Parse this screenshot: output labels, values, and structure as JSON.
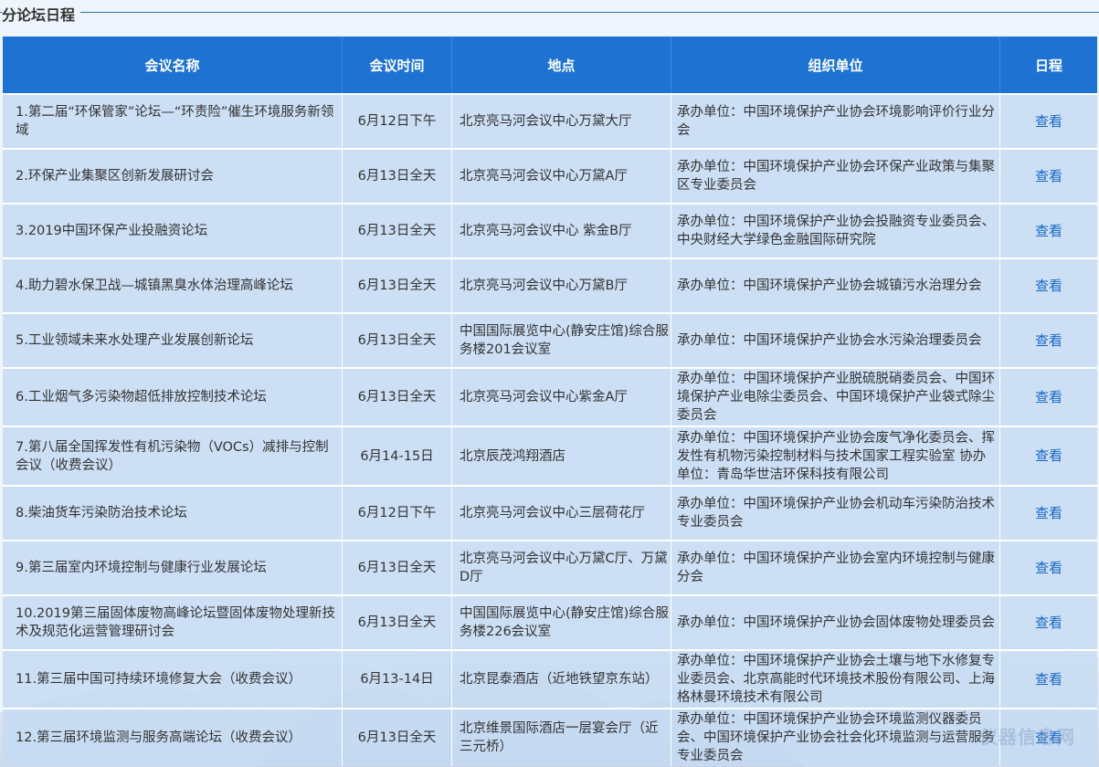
{
  "section": {
    "title": "分论坛日程"
  },
  "table": {
    "headers": [
      "会议名称",
      "会议时间",
      "地点",
      "组织单位",
      "日程"
    ],
    "rows": [
      {
        "name": "1.第二届“环保管家”论坛—“环责险”催生环境服务新领域",
        "time": "6月12日下午",
        "location": "北京亮马河会议中心万黛大厅",
        "organizer": "承办单位：中国环境保护产业协会环境影响评价行业分会",
        "action": "查看"
      },
      {
        "name": "2.环保产业集聚区创新发展研讨会",
        "time": "6月13日全天",
        "location": "北京亮马河会议中心万黛A厅",
        "organizer": "承办单位：中国环境保护产业协会环保产业政策与集聚区专业委员会",
        "action": "查看"
      },
      {
        "name": "3.2019中国环保产业投融资论坛",
        "time": "6月13日全天",
        "location": "北京亮马河会议中心 紫金B厅",
        "organizer": "承办单位：中国环境保护产业协会投融资专业委员会、 中央财经大学绿色金融国际研究院",
        "action": "查看"
      },
      {
        "name": "4.助力碧水保卫战—城镇黑臭水体治理高峰论坛",
        "time": "6月13日全天",
        "location": "北京亮马河会议中心万黛B厅",
        "organizer": "承办单位：中国环境保护产业协会城镇污水治理分会",
        "action": "查看"
      },
      {
        "name": "5.工业领域未来水处理产业发展创新论坛",
        "time": "6月13日全天",
        "location": "中国国际展览中心(静安庄馆)综合服务楼201会议室",
        "organizer": "承办单位：中国环境保护产业协会水污染治理委员会",
        "action": "查看"
      },
      {
        "name": "6.工业烟气多污染物超低排放控制技术论坛",
        "time": "6月13日全天",
        "location": "北京亮马河会议中心紫金A厅",
        "organizer": "承办单位：中国环境保护产业脱硫脱硝委员会、中国环境保护产业电除尘委员会、中国环境保护产业袋式除尘委员会",
        "action": "查看"
      },
      {
        "name": "7.第八届全国挥发性有机污染物（VOCs）减排与控制会议（收费会议）",
        "time": "6月14-15日",
        "location": "北京辰茂鸿翔酒店",
        "organizer": "承办单位：中国环境保护产业协会废气净化委员会、挥发性有机物污染控制材料与技术国家工程实验室 协办单位：青岛华世洁环保科技有限公司",
        "action": "查看"
      },
      {
        "name": "8.柴油货车污染防治技术论坛",
        "time": "6月12日下午",
        "location": "北京亮马河会议中心三层荷花厅",
        "organizer": "承办单位：中国环境保护产业协会机动车污染防治技术专业委员会",
        "action": "查看"
      },
      {
        "name": "9.第三届室内环境控制与健康行业发展论坛",
        "time": "6月13日全天",
        "location": "北京亮马河会议中心万黛C厅、万黛D厅",
        "organizer": "承办单位：中国环境保护产业协会室内环境控制与健康分会",
        "action": "查看"
      },
      {
        "name": "10.2019第三届固体废物高峰论坛暨固体废物处理新技术及规范化运营管理研讨会",
        "time": "6月13日全天",
        "location": "中国国际展览中心(静安庄馆)综合服务楼226会议室",
        "organizer": "承办单位：中国环境保护产业协会固体废物处理委员会",
        "action": "查看"
      },
      {
        "name": "11.第三届中国可持续环境修复大会（收费会议）",
        "time": "6月13-14日",
        "location": "北京昆泰酒店（近地铁望京东站）",
        "organizer": "承办单位：中国环境保护产业协会土壤与地下水修复专业委员会、北京高能时代环境技术股份有限公司、上海格林曼环境技术有限公司",
        "action": "查看"
      },
      {
        "name": "12.第三届环境监测与服务高端论坛（收费会议）",
        "time": "6月13日全天",
        "location": "北京维景国际酒店一层宴会厅（近三元桥）",
        "organizer": "承办单位：中国环境保护产业协会环境监测仪器委员会、中国环境保护产业协会社会化环境监测与运营服务专业委员会",
        "action": "查看"
      }
    ]
  },
  "watermark": {
    "text": "仪器信息网"
  },
  "colors": {
    "header_bg": "#1e73d2",
    "row_bg": "#c4dbf3",
    "link": "#1667c6",
    "accent_line": "#2b6fc3"
  }
}
